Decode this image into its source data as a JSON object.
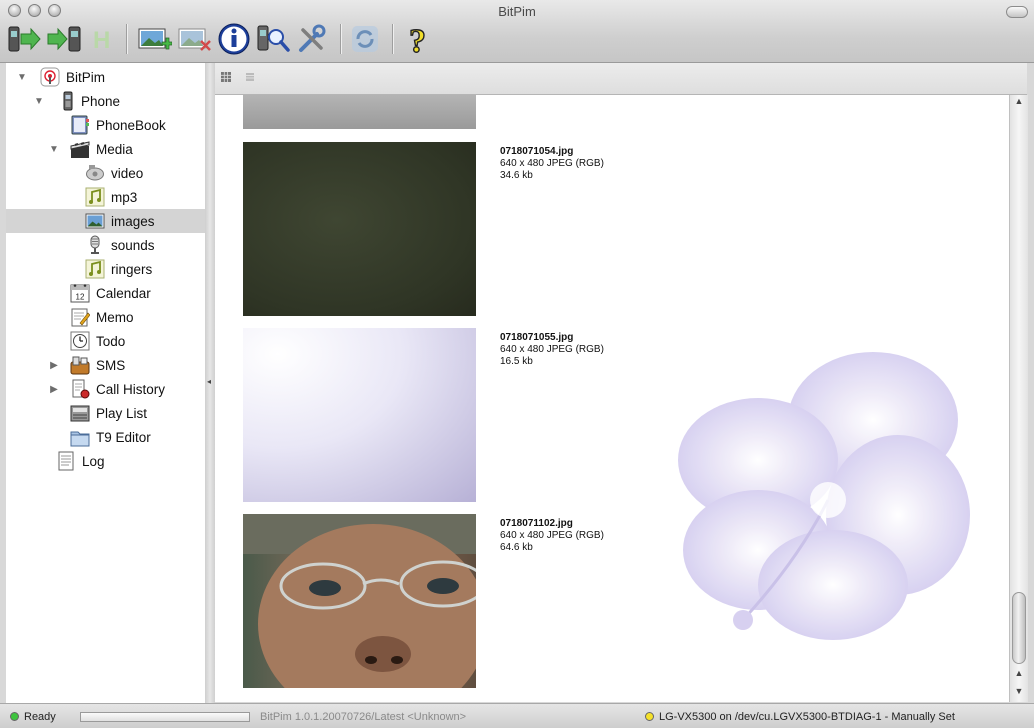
{
  "window": {
    "title": "BitPim"
  },
  "colors": {
    "accent_selection": "#d4d4d4",
    "status_ready": "#3ec43e",
    "status_device": "#f5e12a"
  },
  "toolbar": {
    "buttons": [
      {
        "name": "get-phone-data-icon"
      },
      {
        "name": "send-phone-data-icon"
      },
      {
        "name": "history-icon"
      },
      {
        "name": "add-image-icon"
      },
      {
        "name": "delete-image-icon"
      },
      {
        "name": "info-icon"
      },
      {
        "name": "detect-phone-icon"
      },
      {
        "name": "settings-icon"
      },
      {
        "name": "refresh-icon"
      },
      {
        "name": "help-icon"
      }
    ]
  },
  "sidebar": {
    "items": [
      {
        "label": "BitPim"
      },
      {
        "label": "Phone"
      },
      {
        "label": "PhoneBook"
      },
      {
        "label": "Media"
      },
      {
        "label": "video"
      },
      {
        "label": "mp3"
      },
      {
        "label": "images"
      },
      {
        "label": "sounds"
      },
      {
        "label": "ringers"
      },
      {
        "label": "Calendar"
      },
      {
        "label": "Memo"
      },
      {
        "label": "Todo"
      },
      {
        "label": "SMS"
      },
      {
        "label": "Call History"
      },
      {
        "label": "Play List"
      },
      {
        "label": "T9 Editor"
      },
      {
        "label": "Log"
      }
    ],
    "selected": "images",
    "calendar_day": "12"
  },
  "images": [
    {
      "filename": "0718071054.jpg",
      "dimensions": "640 x 480 JPEG (RGB)",
      "size": "34.6 kb"
    },
    {
      "filename": "0718071055.jpg",
      "dimensions": "640 x 480 JPEG (RGB)",
      "size": "16.5 kb"
    },
    {
      "filename": "0718071102.jpg",
      "dimensions": "640 x 480 JPEG (RGB)",
      "size": "64.6 kb"
    }
  ],
  "status": {
    "ready": "Ready",
    "version": "BitPim 1.0.1.20070726/Latest <Unknown>",
    "device": "LG-VX5300 on /dev/cu.LGVX5300-BTDIAG-1 - Manually Set"
  }
}
